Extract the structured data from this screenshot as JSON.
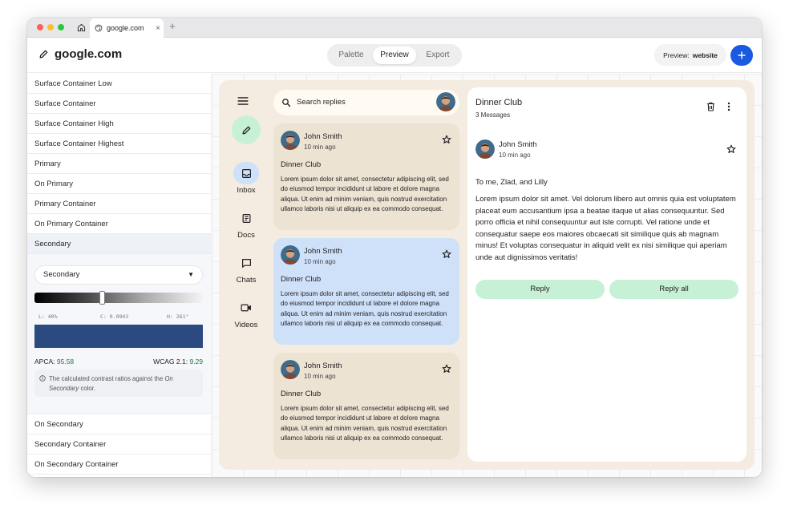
{
  "browser": {
    "tab_title": "google.com",
    "tab_close": "×",
    "new_tab": "+"
  },
  "header": {
    "site": "google.com",
    "segments": [
      "Palette",
      "Preview",
      "Export"
    ],
    "active_segment": "Preview",
    "preview_label": "Preview:",
    "preview_value": "website",
    "accent": "#1a5ae0"
  },
  "color_roles": {
    "top": [
      "Surface Container Low",
      "Surface Container",
      "Surface Container High",
      "Surface Container Highest",
      "Primary",
      "On Primary",
      "Primary Container",
      "On Primary Container",
      "Secondary"
    ],
    "bottom": [
      "On Secondary",
      "Secondary Container",
      "On Secondary Container"
    ]
  },
  "editor": {
    "dropdown_value": "Secondary",
    "lightness": "L: 40%",
    "chroma": "C: 0.0943",
    "hue": "H: 261°",
    "swatch_color": "#2d4a80",
    "apca_label": "APCA:",
    "apca_value": "95.58",
    "wcag_label": "WCAG 2.1:",
    "wcag_value": "9.29",
    "note_prefix": "The calculated contrast ratios against the ",
    "note_role": "On Secondary",
    "note_suffix": " color."
  },
  "mail": {
    "nav": [
      {
        "label": "Inbox",
        "icon": "inbox-icon"
      },
      {
        "label": "Docs",
        "icon": "docs-icon"
      },
      {
        "label": "Chats",
        "icon": "chat-icon"
      },
      {
        "label": "Videos",
        "icon": "video-icon"
      }
    ],
    "search_placeholder": "Search replies",
    "messages": [
      {
        "sender": "John Smith",
        "time": "10 min ago",
        "subject": "Dinner Club",
        "body": "Lorem ipsum dolor sit amet, consectetur adipiscing elit, sed do eiusmod tempor incididunt ut labore et dolore magna aliqua. Ut enim ad minim veniam, quis nostrud exercitation ullamco laboris nisi ut aliquip ex ea commodo consequat."
      },
      {
        "sender": "John Smith",
        "time": "10 min ago",
        "subject": "Dinner Club",
        "body": "Lorem ipsum dolor sit amet, consectetur adipiscing elit, sed do eiusmod tempor incididunt ut labore et dolore magna aliqua. Ut enim ad minim veniam, quis nostrud exercitation ullamco laboris nisi ut aliquip ex ea commodo consequat."
      },
      {
        "sender": "John Smith",
        "time": "10 min ago",
        "subject": "Dinner Club",
        "body": "Lorem ipsum dolor sit amet, consectetur adipiscing elit, sed do eiusmod tempor incididunt ut labore et dolore magna aliqua. Ut enim ad minim veniam, quis nostrud exercitation ullamco laboris nisi ut aliquip ex ea commodo consequat."
      }
    ],
    "thread": {
      "title": "Dinner Club",
      "count": "3 Messages",
      "sender": "John Smith",
      "time": "10 min ago",
      "recipients": "To me, Zlad, and Lilly",
      "body": "Lorem ipsum dolor sit amet. Vel dolorum libero aut omnis quia est voluptatem placeat eum accusantium ipsa a beatae itaque ut alias consequuntur. Sed porro officia et nihil consequuntur aut iste corrupti. Vel ratione unde et consequatur saepe eos maiores obcaecati sit similique quis ab magnam minus! Et voluptas consequatur in aliquid velit ex nisi similique qui aperiam unde aut dignissimos veritatis!",
      "reply_label": "Reply",
      "reply_all_label": "Reply all"
    }
  }
}
